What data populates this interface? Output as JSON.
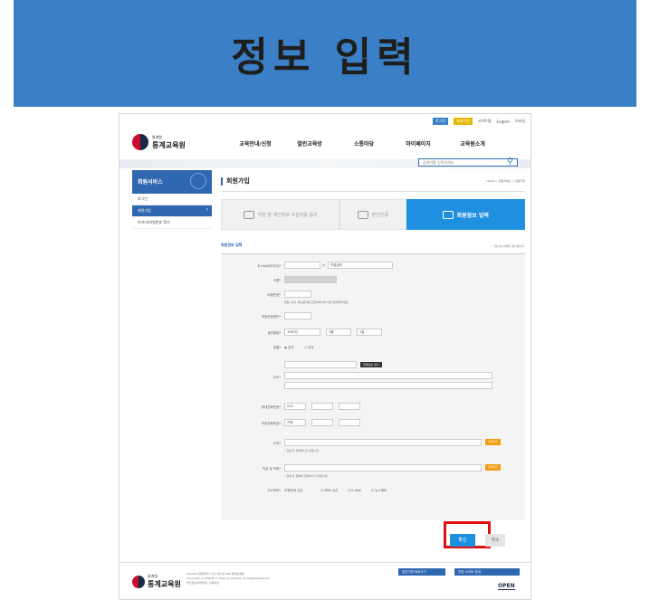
{
  "banner": {
    "title": "정보 입력"
  },
  "topbar": {
    "login": "로그인",
    "join": "회원가입",
    "sitemap": "사이트맵",
    "english": "English",
    "mode": "모바일"
  },
  "logo": {
    "small": "통계청",
    "big": "통계교육원"
  },
  "gnb": [
    "교육안내/신청",
    "열린교육방",
    "소통마당",
    "마이페이지",
    "교육원소개"
  ],
  "search": {
    "placeholder": "검색어를 입력하세요."
  },
  "sidebar": {
    "title": "회원서비스",
    "items": [
      "로그인",
      "회원가입",
      "아이디/비밀번호 찾기"
    ]
  },
  "page": {
    "title": "회원가입",
    "breadcrumb": "Home > 회원서비스 > 회원가입"
  },
  "steps": [
    {
      "label": "약관 및 개인정보 수집이용 동의"
    },
    {
      "label": "본인인증"
    },
    {
      "label": "회원정보 입력"
    }
  ],
  "form": {
    "section_title": "회원정보 입력",
    "required_note": "* 표시된 항목은 필수입니다.",
    "labels": {
      "email": "E-mail(아이디)*",
      "name": "이름*",
      "password": "비밀번호*",
      "password_confirm": "비밀번호확인*",
      "birth": "생년월일*",
      "gender": "성별*",
      "address": "주소*",
      "mobile": "휴대전화번호*",
      "phone": "직장전화번호*",
      "org": "소속*",
      "position": "직급 및 직위*",
      "receive": "수신여부*"
    },
    "email_domain": "직접입력",
    "password_hint": "영문, 숫자, 특수문자를 조합하여 8자 이상 입력해주세요.",
    "birth": {
      "year": "1987년",
      "month": "1월",
      "day": "1일"
    },
    "gender": {
      "male": "남자",
      "female": "여자"
    },
    "zip_button": "우편번호 찾기",
    "mobile_prefix": "010",
    "phone_prefix": "선택",
    "org_button": "검색하기",
    "org_hint": "* 검색 후 선택하시기 바랍니다.",
    "position_button": "검색하기",
    "position_hint": "* 검색 후 정확히 입력하시기 바랍니다.",
    "receive": {
      "label": "교육안내 수신",
      "sms": "SMS 수신",
      "email": "E-mail",
      "news": "뉴스레터"
    }
  },
  "buttons": {
    "confirm": "확인",
    "cancel": "취소"
  },
  "footer": {
    "text_line1": "(35220) 대전광역시 서구 청사로 189 통계교육원",
    "text_line2": "Copyright (c) Statistics Training Institute. All Rights Reserved.",
    "text_line3": "개인정보처리방침 | 이용약관",
    "select1": "유관기관 바로가기",
    "select2": "관련 사이트 안내",
    "open_badge": "OPEN"
  },
  "colors": {
    "banner": "#3b7fc6",
    "primary": "#2f67b0",
    "active_step": "#1f8fe0",
    "highlight": "#e01010"
  }
}
